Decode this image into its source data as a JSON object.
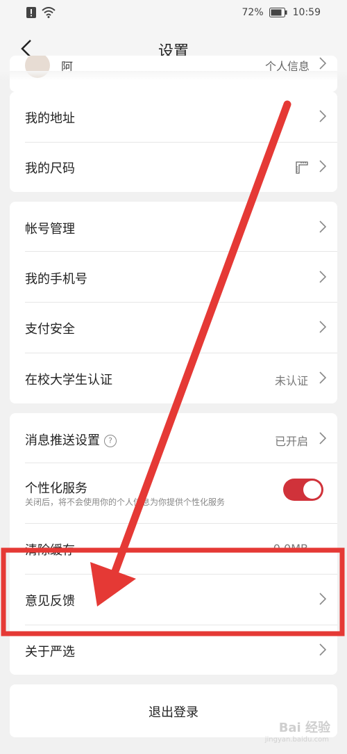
{
  "status_bar": {
    "battery": "72%",
    "time": "10:59"
  },
  "header": {
    "title": "设置"
  },
  "profile_row": {
    "name": "阿",
    "link": "个人信息"
  },
  "group1": {
    "items": [
      {
        "label": "我的地址"
      },
      {
        "label": "我的尺码"
      }
    ]
  },
  "group2": {
    "items": [
      {
        "label": "帐号管理"
      },
      {
        "label": "我的手机号"
      },
      {
        "label": "支付安全"
      },
      {
        "label": "在校大学生认证",
        "value": "未认证"
      }
    ]
  },
  "group3": {
    "push": {
      "label": "消息推送设置",
      "help": "?",
      "value": "已开启"
    },
    "personal": {
      "label": "个性化服务",
      "desc": "关闭后，将不会使用你的个人信息为你提供个性化服务",
      "enabled": true
    },
    "cache": {
      "label": "清除缓存",
      "value": "0.0MB"
    },
    "feedback": {
      "label": "意见反馈"
    },
    "about": {
      "label": "关于严选"
    }
  },
  "logout": {
    "label": "退出登录"
  },
  "watermark": {
    "text": "Bai 经验",
    "sub": "jingyan.baidu.com"
  },
  "colors": {
    "toggle_on": "#d0323a",
    "annotation": "#e53935"
  }
}
